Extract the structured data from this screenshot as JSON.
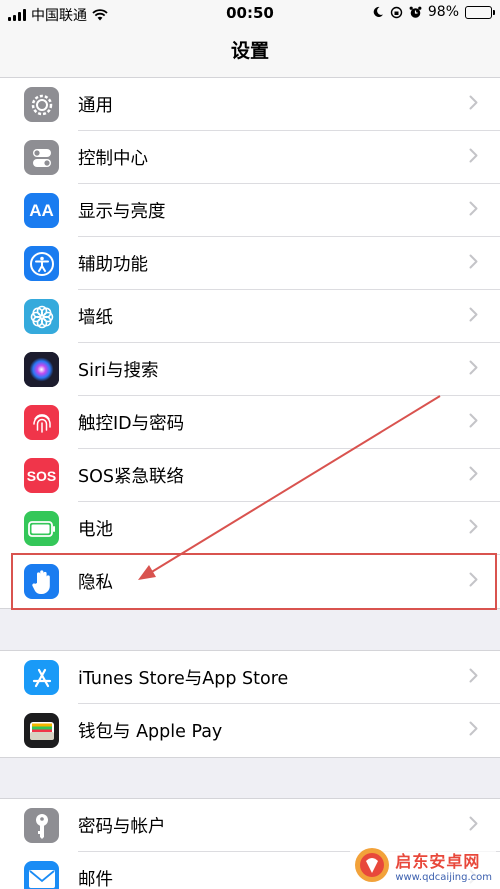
{
  "status_bar": {
    "carrier": "中国联通",
    "time": "00:50",
    "battery_percent": "98%",
    "battery_level": 0.98
  },
  "nav": {
    "title": "设置"
  },
  "groups": [
    {
      "items": [
        {
          "label": "通用",
          "icon": "gear-icon",
          "color": "#8e8e93"
        },
        {
          "label": "控制中心",
          "icon": "toggles-icon",
          "color": "#8e8e93"
        },
        {
          "label": "显示与亮度",
          "icon": "text-size-icon",
          "color": "#1a7cf0",
          "glyph": "AA"
        },
        {
          "label": "辅助功能",
          "icon": "accessibility-icon",
          "color": "#1a7cf0"
        },
        {
          "label": "墙纸",
          "icon": "flower-icon",
          "color": "#35aadc"
        },
        {
          "label": "Siri与搜索",
          "icon": "siri-icon",
          "color": "#1c1c2e"
        },
        {
          "label": "触控ID与密码",
          "icon": "fingerprint-icon",
          "color": "#f0354a"
        },
        {
          "label": "SOS紧急联络",
          "icon": "sos-icon",
          "color": "#f0354a",
          "glyph": "SOS"
        },
        {
          "label": "电池",
          "icon": "battery-icon",
          "color": "#34c759"
        },
        {
          "label": "隐私",
          "icon": "hand-icon",
          "color": "#1a7cf0"
        }
      ]
    },
    {
      "items": [
        {
          "label": "iTunes Store与App Store",
          "icon": "app-store-icon",
          "color": "#1a9af7"
        },
        {
          "label": "钱包与 Apple Pay",
          "icon": "wallet-icon",
          "color": "#1c1c1e"
        }
      ]
    },
    {
      "items": [
        {
          "label": "密码与帐户",
          "icon": "key-icon",
          "color": "#8e8e93"
        },
        {
          "label": "邮件",
          "icon": "mail-icon",
          "color": "#1a8cf5"
        }
      ]
    }
  ],
  "watermark": {
    "title": "启东安卓网",
    "url": "www.qdcaijing.com"
  }
}
